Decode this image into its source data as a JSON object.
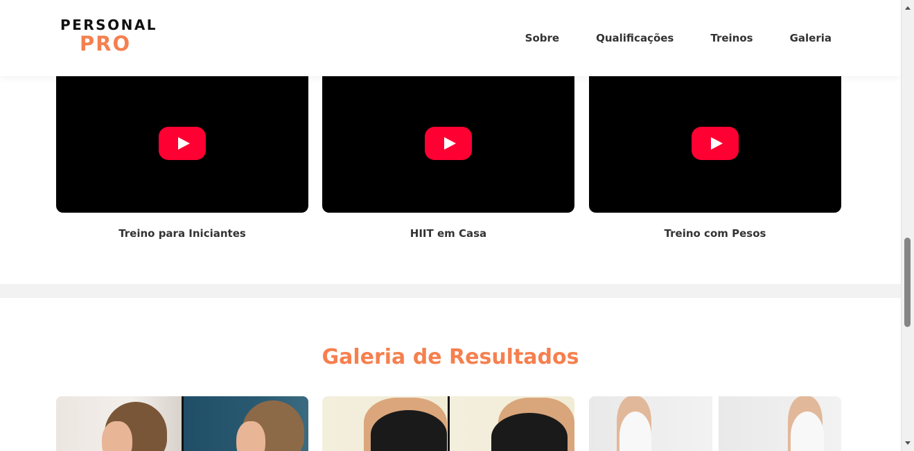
{
  "header": {
    "logo_top": "PERSONAL",
    "logo_bottom": "PRO",
    "nav": [
      {
        "label": "Sobre"
      },
      {
        "label": "Qualificações"
      },
      {
        "label": "Treinos"
      },
      {
        "label": "Galeria"
      }
    ]
  },
  "videos": [
    {
      "caption": "Treino para Iniciantes",
      "icon": "youtube-play-icon"
    },
    {
      "caption": "HIIT em Casa",
      "icon": "youtube-play-icon"
    },
    {
      "caption": "Treino com Pesos",
      "icon": "youtube-play-icon"
    }
  ],
  "gallery": {
    "title": "Galeria de Resultados"
  },
  "colors": {
    "accent": "#f5804f",
    "youtube_red": "#ff0033",
    "text": "#333333"
  }
}
